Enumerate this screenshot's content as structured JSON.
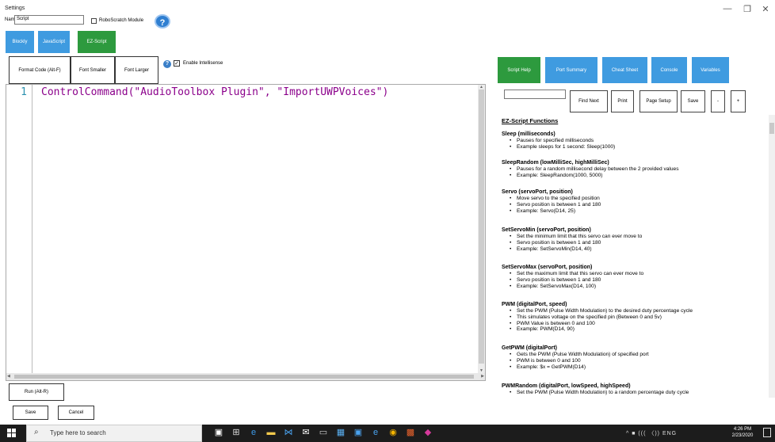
{
  "window": {
    "title": "Settings",
    "minimize_glyph": "—",
    "maximize_glyph": "❐",
    "close_glyph": "✕"
  },
  "name_row": {
    "label": "Name",
    "value": "Script",
    "robo_label": "RoboScratch Module",
    "robo_checked": false,
    "help_glyph": "?"
  },
  "lang_tabs": [
    "Blockly",
    "JavaScript",
    "EZ-Script"
  ],
  "format_buttons": {
    "format": "Format Code (Alt-F)",
    "smaller": "Font Smaller",
    "larger": "Font Larger"
  },
  "intellisense": {
    "info_glyph": "?",
    "check_glyph": "✓",
    "label": "Enable Intellisense",
    "checked": true
  },
  "editor": {
    "line_number": "1",
    "code": "ControlCommand(\"AudioToolbox Plugin\", \"ImportUWPVoices\")"
  },
  "bottom_buttons": {
    "run": "Run (Alt-R)",
    "save": "Save",
    "cancel": "Cancel"
  },
  "right_tabs": [
    "Script Help",
    "Port Summary",
    "Cheat Sheet",
    "Console",
    "Variables"
  ],
  "help_toolbar": {
    "find_next": "Find Next",
    "print": "Print",
    "page_setup": "Page Setup",
    "save": "Save",
    "zoom_out": "-",
    "zoom_in": "+"
  },
  "help": {
    "heading": "EZ-Script Functions",
    "functions": [
      {
        "signature": "Sleep (milliseconds)",
        "items": [
          "Pauses for specified milliseconds",
          "Example sleeps for 1 second: Sleep(1000)"
        ]
      },
      {
        "signature": "SleepRandom (lowMilliSec, highMilliSec)",
        "items": [
          "Pauses for a random millisecond delay between the 2 provided values",
          "Example: SleepRandom(1000, 5000)"
        ]
      },
      {
        "signature": "Servo (servoPort, position)",
        "items": [
          "Move servo to the specified position",
          "Servo position is between 1 and 180",
          "Example: Servo(D14, 25)"
        ]
      },
      {
        "signature": "SetServoMin (servoPort, position)",
        "items": [
          "Set the minimum limit that this servo can ever move to",
          "Servo position is between 1 and 180",
          "Example: SetServoMin(D14, 40)"
        ]
      },
      {
        "signature": "SetServoMax (servoPort, position)",
        "items": [
          "Set the maximum limit that this servo can ever move to",
          "Servo position is between 1 and 180",
          "Example: SetServoMax(D14, 100)"
        ]
      },
      {
        "signature": "PWM (digitalPort, speed)",
        "items": [
          "Set the PWM (Pulse Width Modulation) to the desired duty percentage cycle",
          "This simulates voltage on the specified pin (Between 0 and 5v)",
          "PWM Value is between 0 and 100",
          "Example: PWM(D14, 90)"
        ]
      },
      {
        "signature": "GetPWM (digitalPort)",
        "items": [
          "Gets the PWM (Pulse Width Modulation) of specified port",
          "PWM is between 0 and 100",
          "Example: $x = GetPWM(D14)"
        ]
      },
      {
        "signature": "PWMRandom (digitalPort, lowSpeed, highSpeed)",
        "items": [
          "Set the PWM (Pulse Width Modulation) to a random percentage duty cycle"
        ]
      }
    ]
  },
  "taskbar": {
    "search_placeholder": "Type here to search",
    "apps": [
      "task-view",
      "widgets",
      "edge",
      "file-explorer",
      "visual-studio",
      "mail",
      "terminal",
      "photos",
      "store",
      "chrome",
      "office",
      "app-pink"
    ],
    "app_icons": [
      {
        "name": "task-view-icon",
        "glyph": "▣",
        "color": "#ffffff"
      },
      {
        "name": "widgets-icon",
        "glyph": "⊞",
        "color": "#dddddd"
      },
      {
        "name": "edge-icon",
        "glyph": "e",
        "color": "#3d9be9"
      },
      {
        "name": "file-explorer-icon",
        "glyph": "▬",
        "color": "#f2c94c"
      },
      {
        "name": "visual-studio-icon",
        "glyph": "⋈",
        "color": "#4aa3f0"
      },
      {
        "name": "mail-icon",
        "glyph": "✉",
        "color": "#ffffff"
      },
      {
        "name": "terminal-icon",
        "glyph": "▭",
        "color": "#cfcfcf"
      },
      {
        "name": "photos-icon",
        "glyph": "▦",
        "color": "#5ab0f2"
      },
      {
        "name": "store-icon",
        "glyph": "▣",
        "color": "#4aa3f0"
      },
      {
        "name": "edge-alt-icon",
        "glyph": "e",
        "color": "#4aa3f0"
      },
      {
        "name": "chrome-icon",
        "glyph": "◉",
        "color": "#f4b400"
      },
      {
        "name": "office-icon",
        "glyph": "▩",
        "color": "#e8622c"
      },
      {
        "name": "app-pink-icon",
        "glyph": "◆",
        "color": "#d63a9c"
      }
    ],
    "tray_text": "^ ■ ((( 〈)) ENG",
    "time": "4:26 PM",
    "date": "2/23/2020"
  }
}
